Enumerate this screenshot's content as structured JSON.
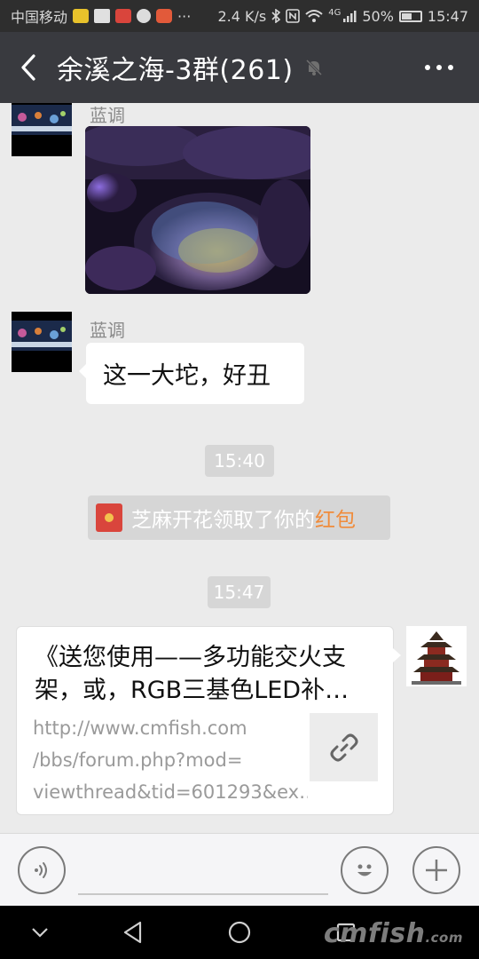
{
  "status_bar": {
    "carrier": "中国移动",
    "more_indicator": "···",
    "speed": "2.4 K/s",
    "network": "4G",
    "battery": "50%",
    "time": "15:47"
  },
  "header": {
    "title": "余溪之海-3群(261)"
  },
  "messages": {
    "sender_1": "蓝调",
    "text_message": "这一大坨，好丑",
    "time_1": "15:40",
    "system_notice": {
      "prefix": "芝麻开花领取了你的",
      "link": "红包"
    },
    "time_2": "15:47",
    "link_card": {
      "title_line_1": "《送您使用——多功能交火支",
      "title_line_2": "架，或，RGB三基色LED补…",
      "url_line_1": "http://www.cmfish.com",
      "url_line_2": "/bbs/forum.php?mod=",
      "url_line_3": "viewthread&tid=601293&ex…"
    }
  },
  "watermark": {
    "main": "cmfish",
    "suffix": ".com"
  },
  "icons": {
    "back": "chevron-left-icon",
    "mute": "bell-off-icon",
    "more": "more-icon",
    "voice": "voice-icon",
    "emoji": "emoji-icon",
    "plus": "plus-icon",
    "link": "link-icon"
  },
  "colors": {
    "title_bar": "#393a3f",
    "status_bar": "#2e2e2e",
    "chat_bg": "#ebebeb",
    "time_pill": "#d6d6d6",
    "red_packet_link": "#f08b3a"
  }
}
